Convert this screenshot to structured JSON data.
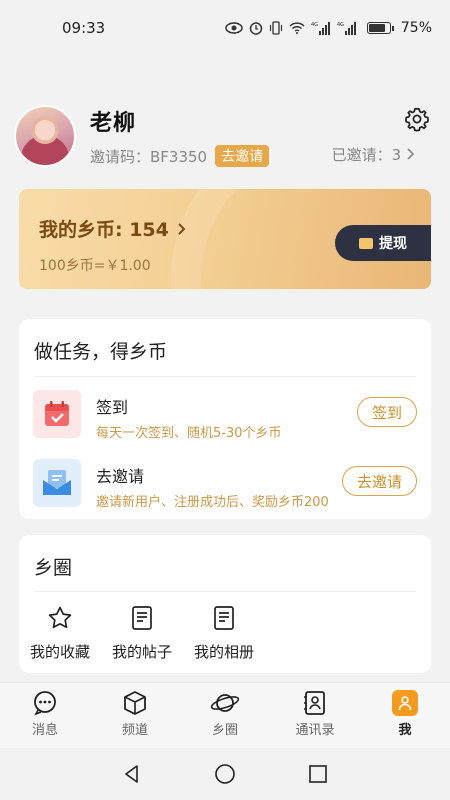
{
  "status_bar": {
    "time": "09:33",
    "battery": "75%"
  },
  "profile": {
    "name": "老柳",
    "invite_code_label": "邀请码：BF3350",
    "invite_button": "去邀请",
    "invited": "已邀请：3"
  },
  "coins": {
    "title": "我的乡币: 154",
    "rate": "100乡币=￥1.00",
    "withdraw": "提现"
  },
  "tasks": {
    "title": "做任务，得乡币",
    "items": [
      {
        "name": "签到",
        "desc": "每天一次签到、随机5-30个乡币",
        "button": "签到",
        "icon": "calendar-icon"
      },
      {
        "name": "去邀请",
        "desc": "邀请新用户、注册成功后、奖励乡币200",
        "button": "去邀请",
        "icon": "mail-icon"
      }
    ]
  },
  "circle": {
    "title": "乡圈",
    "items": [
      {
        "label": "我的收藏",
        "icon": "star-icon"
      },
      {
        "label": "我的帖子",
        "icon": "document-icon"
      },
      {
        "label": "我的相册",
        "icon": "document-icon"
      }
    ]
  },
  "tabs": [
    {
      "label": "消息",
      "icon": "message-icon"
    },
    {
      "label": "频道",
      "icon": "cube-icon"
    },
    {
      "label": "乡圈",
      "icon": "planet-icon"
    },
    {
      "label": "通讯录",
      "icon": "contacts-icon"
    },
    {
      "label": "我",
      "icon": "person-icon",
      "active": true
    }
  ],
  "colors": {
    "accent": "#e7a84a",
    "active_tab": "#f39b1f",
    "withdraw_bg": "#2d3142"
  }
}
